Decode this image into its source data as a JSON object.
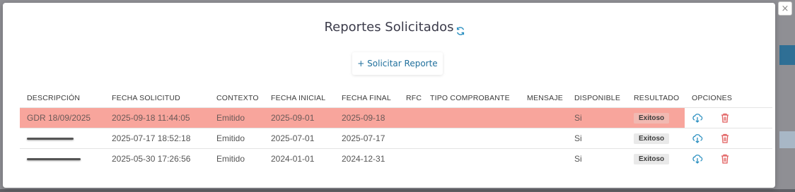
{
  "modal": {
    "title": "Reportes Solicitados",
    "request_button": "+ Solicitar Reporte",
    "close_label": "×"
  },
  "table": {
    "headers": [
      "DESCRIPCIÓN",
      "FECHA SOLICITUD",
      "CONTEXTO",
      "FECHA INICIAL",
      "FECHA FINAL",
      "RFC",
      "TIPO COMPROBANTE",
      "MENSAJE",
      "DISPONIBLE",
      "RESULTADO",
      "OPCIONES"
    ],
    "rows": [
      {
        "descripcion": "GDR 18/09/2025",
        "fecha_solicitud": "2025-09-18 11:44:05",
        "contexto": "Emitido",
        "fecha_inicial": "2025-09-01",
        "fecha_final": "2025-09-18",
        "rfc": "",
        "tipo_comprobante": "",
        "mensaje": "",
        "disponible": "Si",
        "resultado": "Exitoso"
      },
      {
        "descripcion": "",
        "fecha_solicitud": "2025-07-17 18:52:18",
        "contexto": "Emitido",
        "fecha_inicial": "2025-07-01",
        "fecha_final": "2025-07-17",
        "rfc": "",
        "tipo_comprobante": "",
        "mensaje": "",
        "disponible": "Si",
        "resultado": "Exitoso"
      },
      {
        "descripcion": "",
        "fecha_solicitud": "2025-05-30 17:26:56",
        "contexto": "Emitido",
        "fecha_inicial": "2024-01-01",
        "fecha_final": "2024-12-31",
        "rfc": "",
        "tipo_comprobante": "",
        "mensaje": "",
        "disponible": "Si",
        "resultado": "Exitoso"
      }
    ]
  },
  "colors": {
    "highlight_row": "#f8a59c",
    "accent": "#1f6f9c",
    "delete": "#e05a5a"
  },
  "icons": {
    "refresh": "refresh-icon",
    "download": "cloud-download-icon",
    "delete": "trash-icon"
  }
}
